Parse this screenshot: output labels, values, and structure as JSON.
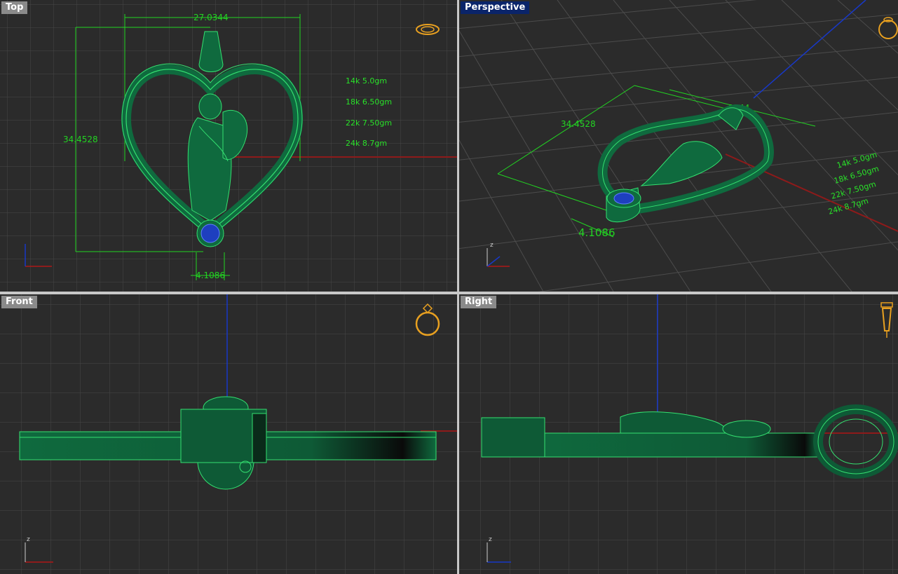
{
  "viewports": {
    "top": {
      "title": "Top",
      "active": false
    },
    "perspective": {
      "title": "Perspective",
      "active": true
    },
    "front": {
      "title": "Front",
      "active": false
    },
    "right": {
      "title": "Right",
      "active": false
    }
  },
  "dimensions": {
    "width": "27.0344",
    "height": "34.4528",
    "stone": "4.1086"
  },
  "weight_notes": [
    "14k 5.0gm",
    "18k 6.50gm",
    "22k 7.50gm",
    "24k 8.7gm"
  ],
  "perspective_notes": [
    "14k 5.0gm",
    "18k 6.50gm",
    "22k 7.50gm",
    "24k 8.7gm"
  ],
  "perspective_dimensions": {
    "width": ".0344",
    "height": "34.4528",
    "stone": "4.1086"
  },
  "axis_labels": {
    "z": "z"
  },
  "colors": {
    "viewport_bg": "#2b2b2b",
    "grid": "#4a4a4a",
    "model": "#0e5a36",
    "model_edge": "#2fe06a",
    "dimension": "#22d422",
    "stone": "#1e3fbf",
    "active_title": "#0a246a",
    "inactive_title": "#8a8a8a",
    "axis_x": "#b01818",
    "axis_y": "#1838c8"
  },
  "icons": [
    "ring-top-icon",
    "ring-perspective-icon",
    "ring-front-icon",
    "ring-side-icon"
  ]
}
